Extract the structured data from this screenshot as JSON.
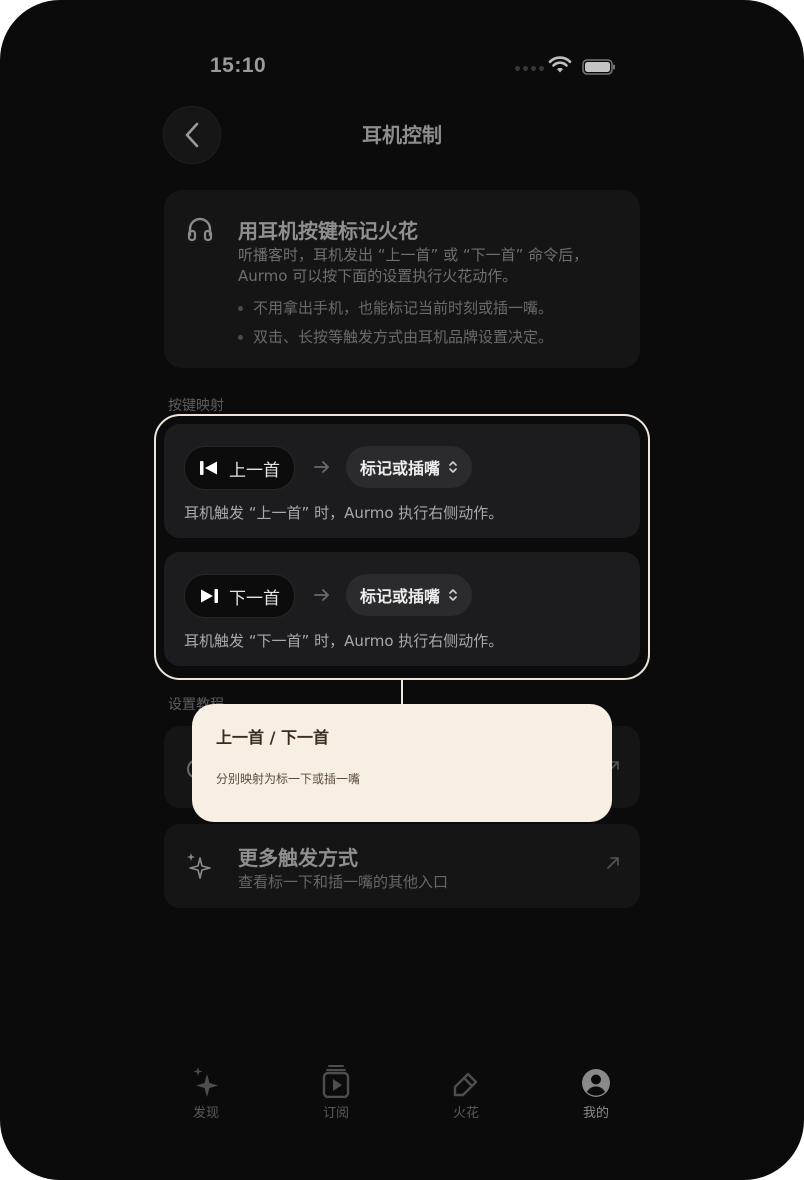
{
  "status": {
    "time": "15:10"
  },
  "header": {
    "title": "耳机控制"
  },
  "info": {
    "title": "用耳机按键标记火花",
    "description": "听播客时，耳机发出 “上一首” 或 “下一首” 命令后，Aurmo 可以按下面的设置执行火花动作。",
    "bullets": [
      "不用拿出手机，也能标记当前时刻或插一嘴。",
      "双击、长按等触发方式由耳机品牌设置决定。"
    ]
  },
  "mapping": {
    "section_label": "按键映射",
    "rows": [
      {
        "key": "上一首",
        "action": "标记或插嘴",
        "description": "耳机触发 “上一首” 时，Aurmo 执行右侧动作。"
      },
      {
        "key": "下一首",
        "action": "标记或插嘴",
        "description": "耳机触发 “下一首” 时，Aurmo 执行右侧动作。"
      }
    ]
  },
  "tutorial": {
    "section_label": "设置教程"
  },
  "more": {
    "title": "更多触发方式",
    "subtitle": "查看标一下和插一嘴的其他入口"
  },
  "tooltip": {
    "title": "上一首 / 下一首",
    "body": "分别映射为标一下或插一嘴"
  },
  "tabs": [
    {
      "label": "发现",
      "icon": "sparkle-icon"
    },
    {
      "label": "订阅",
      "icon": "subscription-icon"
    },
    {
      "label": "火花",
      "icon": "spark-pen-icon"
    },
    {
      "label": "我的",
      "icon": "profile-icon",
      "active": true
    }
  ]
}
